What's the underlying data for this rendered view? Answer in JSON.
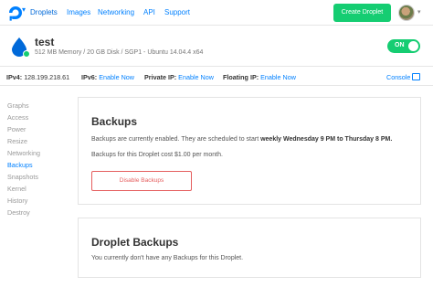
{
  "topnav": {
    "links": [
      {
        "label": "Droplets"
      },
      {
        "label": "Images"
      },
      {
        "label": "Networking"
      },
      {
        "label": "API"
      },
      {
        "label": "Support"
      }
    ],
    "create_button": "Create Droplet",
    "accent_color": "#0080ff",
    "create_color": "#15cd72"
  },
  "droplet": {
    "name": "test",
    "specs": "512 MB Memory / 20 GB Disk / SGP1 - Ubuntu 14.04.4 x64",
    "power_toggle": "ON",
    "status_color": "#15cd72"
  },
  "ipbar": {
    "ipv4_label": "IPv4:",
    "ipv4_value": "128.199.218.61",
    "ipv6_label": "IPv6:",
    "ipv6_link": "Enable Now",
    "private_label": "Private IP:",
    "private_link": "Enable Now",
    "floating_label": "Floating IP:",
    "floating_link": "Enable Now",
    "console": "Console"
  },
  "sidebar": {
    "items": [
      {
        "label": "Graphs"
      },
      {
        "label": "Access"
      },
      {
        "label": "Power"
      },
      {
        "label": "Resize"
      },
      {
        "label": "Networking"
      },
      {
        "label": "Backups"
      },
      {
        "label": "Snapshots"
      },
      {
        "label": "Kernel"
      },
      {
        "label": "History"
      },
      {
        "label": "Destroy"
      }
    ],
    "active": "Backups"
  },
  "backups_panel": {
    "title": "Backups",
    "text_prefix": "Backups are currently enabled. They are scheduled to start ",
    "schedule": "weekly Wednesday 9 PM to Thursday 8 PM.",
    "cost_text": "Backups for this Droplet cost $1.00 per month.",
    "disable_button": "Disable Backups",
    "danger_color": "#e55e5e"
  },
  "droplet_backups_panel": {
    "title": "Droplet Backups",
    "text": "You currently don't have any Backups for this Droplet."
  }
}
